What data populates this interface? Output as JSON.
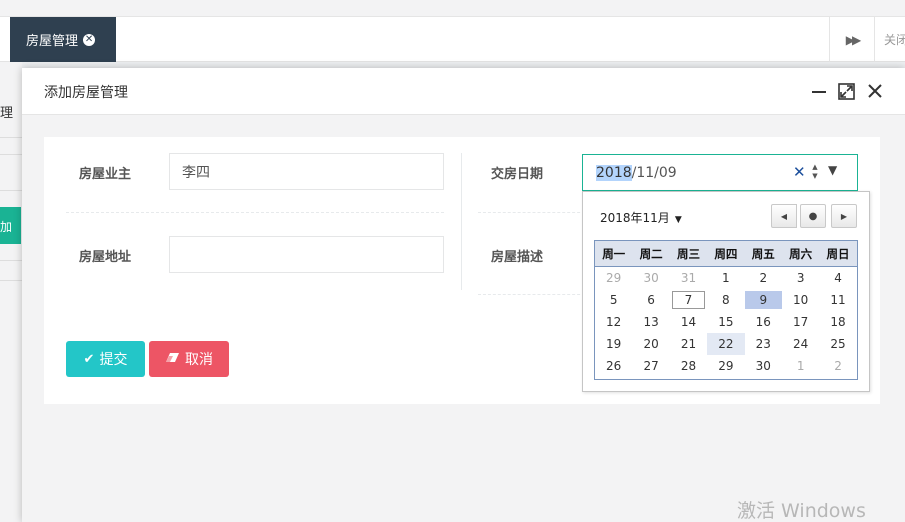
{
  "tabs": {
    "active_label": "房屋管理",
    "close_all_label": "关闭"
  },
  "background": {
    "left_fragment": "理",
    "left_button": "加"
  },
  "modal": {
    "title": "添加房屋管理",
    "fields": {
      "owner_label": "房屋业主",
      "owner_value": "李四",
      "address_label": "房屋地址",
      "address_value": "",
      "delivery_label": "交房日期",
      "delivery_year": "2018",
      "delivery_rest": "/11/09",
      "description_label": "房屋描述"
    },
    "buttons": {
      "submit": "提交",
      "cancel": "取消"
    }
  },
  "calendar": {
    "month_label": "2018年11月",
    "weekdays": [
      "周一",
      "周二",
      "周三",
      "周四",
      "周五",
      "周六",
      "周日"
    ],
    "weeks": [
      [
        "29",
        "30",
        "31",
        "1",
        "2",
        "3",
        "4"
      ],
      [
        "5",
        "6",
        "7",
        "8",
        "9",
        "10",
        "11"
      ],
      [
        "12",
        "13",
        "14",
        "15",
        "16",
        "17",
        "18"
      ],
      [
        "19",
        "20",
        "21",
        "22",
        "23",
        "24",
        "25"
      ],
      [
        "26",
        "27",
        "28",
        "29",
        "30",
        "1",
        "2"
      ]
    ],
    "other_month_cells": [
      [
        0,
        0
      ],
      [
        0,
        1
      ],
      [
        0,
        2
      ],
      [
        4,
        5
      ],
      [
        4,
        6
      ]
    ],
    "today_cell": [
      1,
      2
    ],
    "selected_cell": [
      1,
      4
    ],
    "hover_cell": [
      3,
      3
    ]
  },
  "watermark": "激活 Windows",
  "colors": {
    "sidebar_dark": "#2f4050",
    "primary_green": "#1ab394",
    "submit_cyan": "#23c6c8",
    "cancel_red": "#ed5565"
  }
}
